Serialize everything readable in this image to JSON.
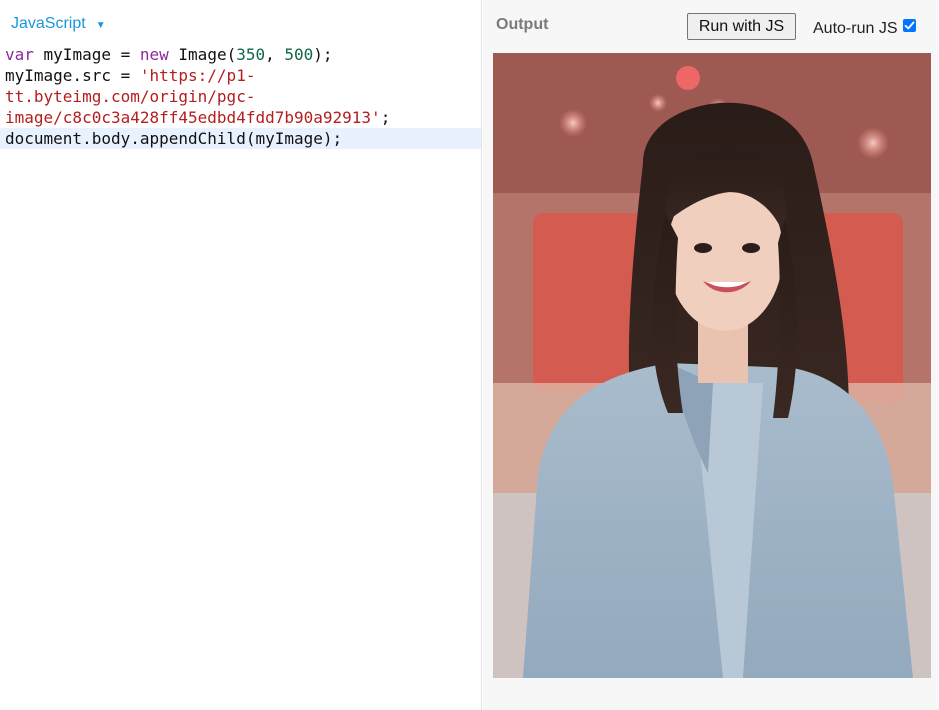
{
  "editor": {
    "language": "JavaScript",
    "code_lines": [
      [
        {
          "t": "var",
          "c": "kw"
        },
        {
          "t": " myImage = "
        },
        {
          "t": "new",
          "c": "kw"
        },
        {
          "t": " Image("
        },
        {
          "t": "350",
          "c": "num"
        },
        {
          "t": ", "
        },
        {
          "t": "500",
          "c": "num"
        },
        {
          "t": ");"
        }
      ],
      [
        {
          "t": "myImage.src = "
        },
        {
          "t": "'https://p1-",
          "c": "str"
        }
      ],
      [
        {
          "t": "tt.byteimg.com/origin/pgc-",
          "c": "str"
        }
      ],
      [
        {
          "t": "image/c8c0c3a428ff45edbd4fdd7b90a92913'",
          "c": "str"
        },
        {
          "t": ";"
        }
      ],
      [
        {
          "t": "document.body.appendChild(myImage);"
        }
      ]
    ],
    "active_line": 4
  },
  "output": {
    "label": "Output",
    "run_button": "Run with JS",
    "autorun_label": "Auto-run JS",
    "autorun_checked": true,
    "image_alt": "Rendered image output"
  },
  "colors": {
    "language_link": "#1a96e0",
    "keyword": "#8b2a9b",
    "number": "#116644",
    "string": "#b41e1e",
    "active_line": "#e8f2ff",
    "checkbox": "#0075ff"
  }
}
